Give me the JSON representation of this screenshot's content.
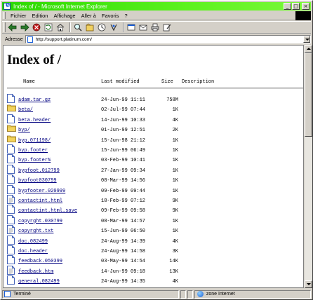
{
  "window": {
    "title": "Index of / - Microsoft Internet Explorer",
    "min_label": "_",
    "max_label": "□",
    "close_label": "×"
  },
  "menu": [
    "Fichier",
    "Edition",
    "Affichage",
    "Aller à",
    "Favoris",
    "?"
  ],
  "toolbar": {
    "icons": [
      "back-icon",
      "forward-icon",
      "stop-icon",
      "refresh-icon",
      "home-icon",
      "search-icon",
      "favorites-icon",
      "history-icon",
      "channels-icon",
      "fullscreen-icon",
      "mail-icon",
      "print-icon",
      "edit-icon"
    ]
  },
  "address": {
    "label": "Adresse",
    "url": "http://support.platinum.com/"
  },
  "page": {
    "heading": "Index of /",
    "col_name": "Name",
    "col_modified": "Last modified",
    "col_size": "Size",
    "col_description": "Description"
  },
  "files": [
    {
      "name": "adam.tar.gz",
      "date": "24-Jun-99 11:11",
      "size": "758M",
      "type": "file"
    },
    {
      "name": "beta/",
      "date": "02-Jul-99 07:44",
      "size": "1K",
      "type": "folder"
    },
    {
      "name": "beta.header",
      "date": "14-Jun-99 10:33",
      "size": "4K",
      "type": "file"
    },
    {
      "name": "byp/",
      "date": "01-Jun-99 12:51",
      "size": "2K",
      "type": "folder"
    },
    {
      "name": "byp.071198/",
      "date": "15-Jun-98 21:12",
      "size": "1K",
      "type": "folder"
    },
    {
      "name": "byp.footer",
      "date": "15-Jun-99 06:49",
      "size": "1K",
      "type": "file"
    },
    {
      "name": "byp.footer%",
      "date": "03-Feb-99 10:41",
      "size": "1K",
      "type": "file"
    },
    {
      "name": "bypfoot.012799",
      "date": "27-Jan-99 09:34",
      "size": "1K",
      "type": "file"
    },
    {
      "name": "bypfoot030799",
      "date": "08-Mar-99 14:56",
      "size": "1K",
      "type": "file"
    },
    {
      "name": "bypfooter.020999",
      "date": "09-Feb-99 09:44",
      "size": "1K",
      "type": "file"
    },
    {
      "name": "contactint.html",
      "date": "18-Feb-99 07:12",
      "size": "9K",
      "type": "text"
    },
    {
      "name": "contactint.html.save",
      "date": "09-Feb-99 09:58",
      "size": "9K",
      "type": "file"
    },
    {
      "name": "copyrght.030799",
      "date": "08-Mar-99 14:57",
      "size": "1K",
      "type": "file"
    },
    {
      "name": "copyrght.txt",
      "date": "15-Jun-99 06:50",
      "size": "1K",
      "type": "text"
    },
    {
      "name": "doc.082499",
      "date": "24-Aug-99 14:39",
      "size": "4K",
      "type": "file"
    },
    {
      "name": "doc.header",
      "date": "24-Aug-99 14:58",
      "size": "3K",
      "type": "file"
    },
    {
      "name": "feedback.050399",
      "date": "03-May-99 14:54",
      "size": "14K",
      "type": "file"
    },
    {
      "name": "feedback.htm",
      "date": "14-Jun-99 09:18",
      "size": "13K",
      "type": "text"
    },
    {
      "name": "general.082499",
      "date": "24-Aug-99 14:35",
      "size": "4K",
      "type": "file"
    }
  ],
  "status": {
    "text": "Terminé",
    "zone": "zone Internet"
  }
}
